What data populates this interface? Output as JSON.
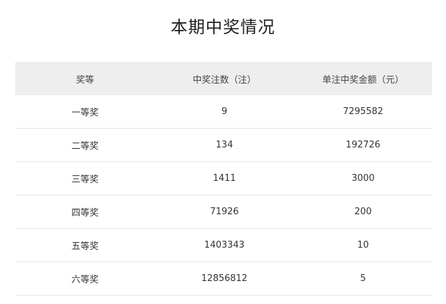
{
  "title": "本期中奖情况",
  "table": {
    "headers": [
      "奖等",
      "中奖注数（注）",
      "单注中奖金额（元）"
    ],
    "rows": [
      {
        "level": "一等奖",
        "count": "9",
        "amount": "7295582"
      },
      {
        "level": "二等奖",
        "count": "134",
        "amount": "192726"
      },
      {
        "level": "三等奖",
        "count": "1411",
        "amount": "3000"
      },
      {
        "level": "四等奖",
        "count": "71926",
        "amount": "200"
      },
      {
        "level": "五等奖",
        "count": "1403343",
        "amount": "10"
      },
      {
        "level": "六等奖",
        "count": "12856812",
        "amount": "5"
      }
    ]
  }
}
